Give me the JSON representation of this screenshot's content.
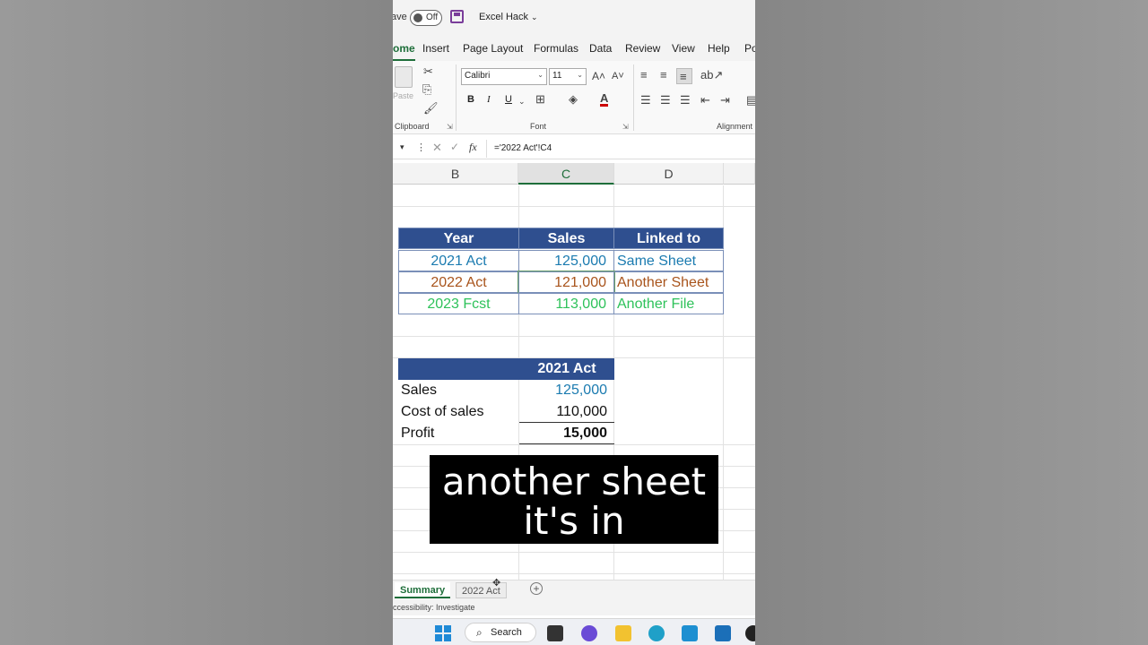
{
  "titlebar": {
    "autosave_label": "ave",
    "autosave_state": "Off",
    "filename": "Excel Hack",
    "chevron": "⌄"
  },
  "menu_tabs": [
    {
      "label": "ome"
    },
    {
      "label": "Insert"
    },
    {
      "label": "Page Layout"
    },
    {
      "label": "Formulas"
    },
    {
      "label": "Data"
    },
    {
      "label": "Review"
    },
    {
      "label": "View"
    },
    {
      "label": "Help"
    },
    {
      "label": "Po"
    }
  ],
  "ribbon": {
    "paste_label": "Paste",
    "clipboard_label": "Clipboard",
    "font_label": "Font",
    "alignment_label": "Alignment",
    "font_name": "Calibri",
    "font_size": "11",
    "bold": "B",
    "italic": "I",
    "underline": "U"
  },
  "formula_bar": {
    "fx": "fx",
    "formula": "='2022 Act'!C4"
  },
  "columns": [
    {
      "label": "B"
    },
    {
      "label": "C"
    },
    {
      "label": "D"
    }
  ],
  "table1": {
    "headers": [
      "Year",
      "Sales",
      "Linked to"
    ],
    "rows": [
      {
        "year": "2021 Act",
        "sales": "125,000",
        "linked": "Same Sheet",
        "color": "#1b7bb0"
      },
      {
        "year": "2022 Act",
        "sales": "121,000",
        "linked": "Another Sheet",
        "color": "#a8541c"
      },
      {
        "year": "2023 Fcst",
        "sales": "113,000",
        "linked": "Another File",
        "color": "#2ec25a"
      }
    ]
  },
  "table2": {
    "header": "2021 Act",
    "rows": [
      {
        "label": "Sales",
        "value": "125,000"
      },
      {
        "label": "Cost of sales",
        "value": "110,000"
      },
      {
        "label": "Profit",
        "value": "15,000"
      }
    ]
  },
  "caption": {
    "line1": "another sheet",
    "line2": "it's in"
  },
  "sheets": {
    "active": "Summary",
    "other": "2022 Act",
    "add": "+"
  },
  "statusbar": {
    "text": "ccessibility: Investigate"
  },
  "taskbar": {
    "search_label": "Search"
  },
  "colors": {
    "header_fill": "#2f4f8f",
    "excel_green": "#1e6e3a"
  }
}
